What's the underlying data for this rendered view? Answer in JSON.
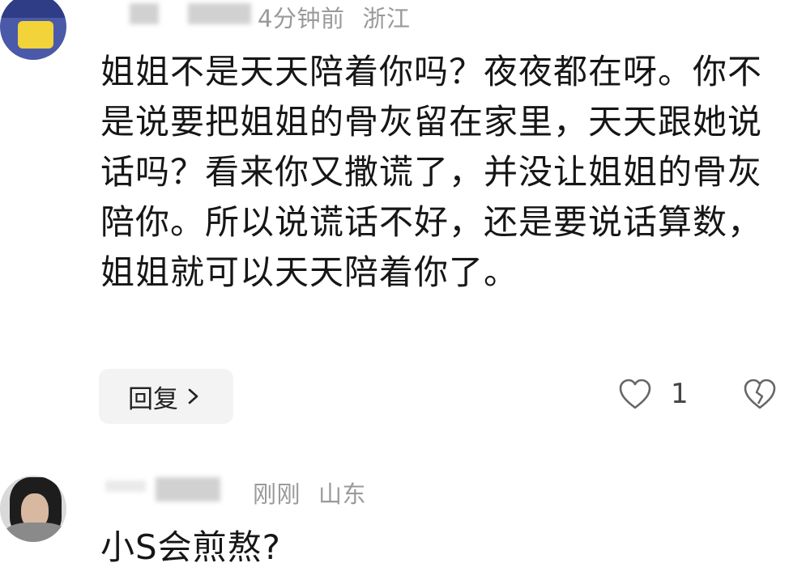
{
  "comments": [
    {
      "time": "4分钟前",
      "location": "浙江",
      "text": "姐姐不是天天陪着你吗？夜夜都在呀。你不是说要把姐姐的骨灰留在家里，天天跟她说话吗？看来你又撒谎了，并没让姐姐的骨灰陪你。所以说谎话不好，还是要说话算数，姐姐就可以天天陪着你了。",
      "reply_label": "回复",
      "like_count": "1"
    },
    {
      "time": "刚刚",
      "location": "山东",
      "text": "小S会煎熬?"
    }
  ],
  "icons": {
    "reply_chevron": "chevron-right-icon",
    "like": "heart-outline-icon",
    "dislike": "broken-heart-icon"
  },
  "colors": {
    "meta_text": "#9a9a9a",
    "body_text": "#161616",
    "reply_bg": "#f3f3f3"
  }
}
